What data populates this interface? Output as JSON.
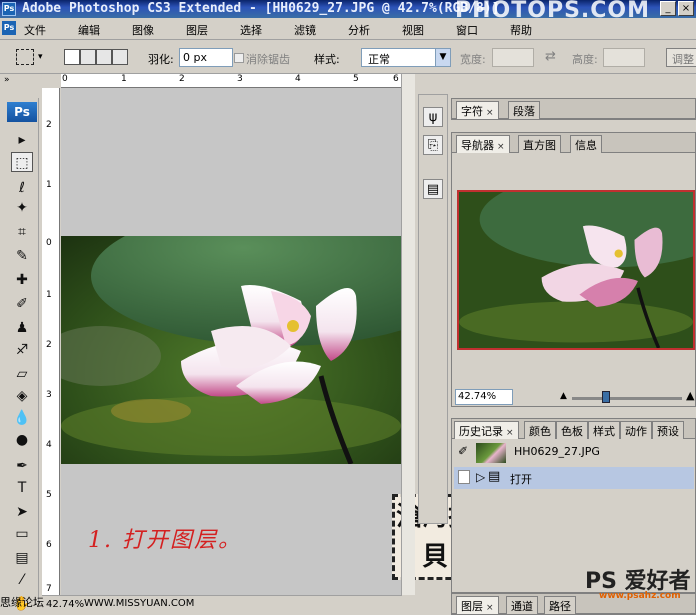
{
  "window": {
    "title": "Adobe Photoshop CS3 Extended - [HH0629_27.JPG @ 42.7%(RGB/8)]",
    "watermark": "PHOTOPS.COM",
    "min_glyph": "_",
    "close_glyph": "×"
  },
  "menu": {
    "items": [
      "文件",
      "编辑",
      "图像",
      "图层",
      "选择",
      "滤镜",
      "分析",
      "视图",
      "窗口",
      "帮助"
    ]
  },
  "options": {
    "feather_label": "羽化:",
    "feather_value": "0 px",
    "antialias_label": "消除锯齿",
    "style_label": "样式:",
    "style_value": "正常",
    "width_label": "宽度:",
    "height_label": "高度:",
    "refine_label": "调整"
  },
  "tools": {
    "logo": "Ps",
    "items": [
      {
        "name": "move-tool-icon",
        "glyph": "▸"
      },
      {
        "name": "marquee-tool-icon",
        "glyph": "⬚"
      },
      {
        "name": "lasso-tool-icon",
        "glyph": "ℓ"
      },
      {
        "name": "magic-wand-tool-icon",
        "glyph": "✦"
      },
      {
        "name": "crop-tool-icon",
        "glyph": "⌗"
      },
      {
        "name": "slice-tool-icon",
        "glyph": "✎"
      },
      {
        "name": "healing-brush-tool-icon",
        "glyph": "✚"
      },
      {
        "name": "brush-tool-icon",
        "glyph": "✐"
      },
      {
        "name": "clone-stamp-tool-icon",
        "glyph": "♟"
      },
      {
        "name": "history-brush-tool-icon",
        "glyph": "♐"
      },
      {
        "name": "eraser-tool-icon",
        "glyph": "▱"
      },
      {
        "name": "paint-bucket-tool-icon",
        "glyph": "◈"
      },
      {
        "name": "blur-tool-icon",
        "glyph": "💧"
      },
      {
        "name": "dodge-tool-icon",
        "glyph": "●"
      },
      {
        "name": "pen-tool-icon",
        "glyph": "✒"
      },
      {
        "name": "type-tool-icon",
        "glyph": "T"
      },
      {
        "name": "path-selection-tool-icon",
        "glyph": "➤"
      },
      {
        "name": "rectangle-tool-icon",
        "glyph": "▭"
      },
      {
        "name": "notes-tool-icon",
        "glyph": "▤"
      },
      {
        "name": "eyedropper-tool-icon",
        "glyph": "⁄"
      },
      {
        "name": "hand-tool-icon",
        "glyph": "✋"
      }
    ]
  },
  "ruler": {
    "top": [
      "0",
      "1",
      "2",
      "3",
      "4",
      "5",
      "6"
    ],
    "left": [
      "2",
      "1",
      "0",
      "1",
      "2",
      "3",
      "4",
      "5",
      "6",
      "7"
    ]
  },
  "document": {
    "note": "1. 打开图层。",
    "seal_text": "滄海拾貝",
    "status_zoom": "42.74%",
    "status_site": "WWW.MISSYUAN.COM",
    "bottom_left": "思缘论坛"
  },
  "panels": {
    "char_tabs": [
      "字符",
      "段落"
    ],
    "nav_tabs": [
      "导航器",
      "直方图",
      "信息"
    ],
    "nav_zoom": "42.74%",
    "history_tabs": [
      "历史记录",
      "颜色",
      "色板",
      "样式",
      "动作",
      "预设"
    ],
    "history_items": [
      "HH0629_27.JPG",
      "打开"
    ],
    "layers_tabs": [
      "图层",
      "通道",
      "路径"
    ]
  },
  "badge": {
    "text": "PS 爱好者",
    "site": "www.psahz.com"
  }
}
